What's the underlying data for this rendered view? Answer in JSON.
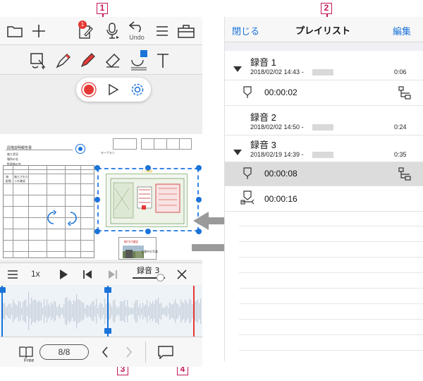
{
  "callouts": [
    "1",
    "2",
    "3",
    "4"
  ],
  "left_panel": {
    "toolbar": {
      "undo_label": "Undo",
      "notification_badge": "1"
    },
    "document": {
      "header_text": "段階説明報告書",
      "row_labels": [
        "施工状況",
        "場所の名",
        "監理者の名"
      ],
      "table_header": "キープラン",
      "cell_a": "海",
      "cell_b": "施工された",
      "cell_c": "配管",
      "cell_d": "られ確認",
      "photo_label": "工事中の写真",
      "red_note": "ここ確認",
      "red_note2": "取付け確認"
    },
    "playback": {
      "speed_label": "1x",
      "recording_label": "録音 3"
    },
    "bottom": {
      "free_label": "Free",
      "page_indicator": "8/8"
    }
  },
  "right_panel": {
    "header": {
      "close_label": "閉じる",
      "title": "プレイリスト",
      "edit_label": "編集"
    },
    "items": [
      {
        "title": "録音 1",
        "date": "2018/02/02 14:43 -",
        "duration": "0:06",
        "expanded": true,
        "bookmarks": [
          {
            "time": "00:00:02",
            "selected": false
          }
        ]
      },
      {
        "title": "録音 2",
        "date": "2018/02/02 14:50 -",
        "duration": "0:24",
        "expanded": false,
        "bookmarks": []
      },
      {
        "title": "録音 3",
        "date": "2018/02/19 14:39 -",
        "duration": "0:35",
        "expanded": true,
        "bookmarks": [
          {
            "time": "00:00:08",
            "selected": true
          },
          {
            "time": "00:00:16",
            "selected": false
          }
        ]
      }
    ]
  },
  "colors": {
    "accent_blue": "#1a73d9",
    "record_red": "#e53935",
    "callout_pink": "#c2185b",
    "selection_dashed": "#3a86e6",
    "waveform_playhead_red": "#e53935",
    "selected_row": "#dcdcdc"
  }
}
